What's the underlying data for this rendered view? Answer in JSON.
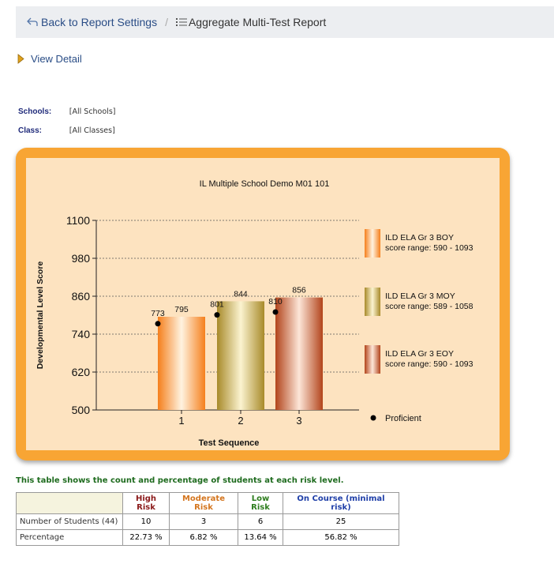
{
  "breadcrumb": {
    "back_label": "Back to Report Settings",
    "separator": "/",
    "current_label": "Aggregate Multi-Test Report"
  },
  "view_detail": {
    "label": "View Detail"
  },
  "filters": {
    "schools_label": "Schools:",
    "schools_value": "[All Schools]",
    "class_label": "Class:",
    "class_value": "[All Classes]"
  },
  "chart_data": {
    "type": "bar",
    "title": "IL Multiple School Demo M01 101",
    "xlabel": "Test Sequence",
    "ylabel": "Developmental Level Score",
    "ylim": [
      500,
      1100
    ],
    "yticks": [
      "1100",
      "980",
      "860",
      "740",
      "620",
      "500"
    ],
    "ytick_values": [
      1100,
      980,
      860,
      740,
      620,
      500
    ],
    "categories": [
      "1",
      "2",
      "3"
    ],
    "series": [
      {
        "name": "ILD ELA Gr 3 BOY",
        "range": "score range: 590 - 1093",
        "value": 795,
        "proficient": 773
      },
      {
        "name": "ILD ELA Gr 3  MOY",
        "range": "score range: 589 - 1058",
        "value": 844,
        "proficient": 801
      },
      {
        "name": "ILD ELA Gr 3 EOY",
        "range": "score range: 590 - 1093",
        "value": 856,
        "proficient": 810
      }
    ],
    "value_labels": [
      "795",
      "844",
      "856"
    ],
    "proficient_labels": [
      "773",
      "801",
      "810"
    ],
    "proficient_legend": "Proficient",
    "grid": true,
    "legend": "right"
  },
  "risk_table": {
    "caption": "This table shows the count and percentage of students at each risk level.",
    "headers": [
      "High Risk",
      "Moderate Risk",
      "Low Risk",
      "On Course (minimal risk)"
    ],
    "header_colors": [
      "#8b1a1a",
      "#d4761f",
      "#2e7d1e",
      "#1f3fa8"
    ],
    "rows": [
      {
        "label": "Number of Students (44)",
        "values": [
          "10",
          "3",
          "6",
          "25"
        ]
      },
      {
        "label": "Percentage",
        "values": [
          "22.73 %",
          "6.82 %",
          "13.64 %",
          "56.82 %"
        ]
      }
    ]
  }
}
